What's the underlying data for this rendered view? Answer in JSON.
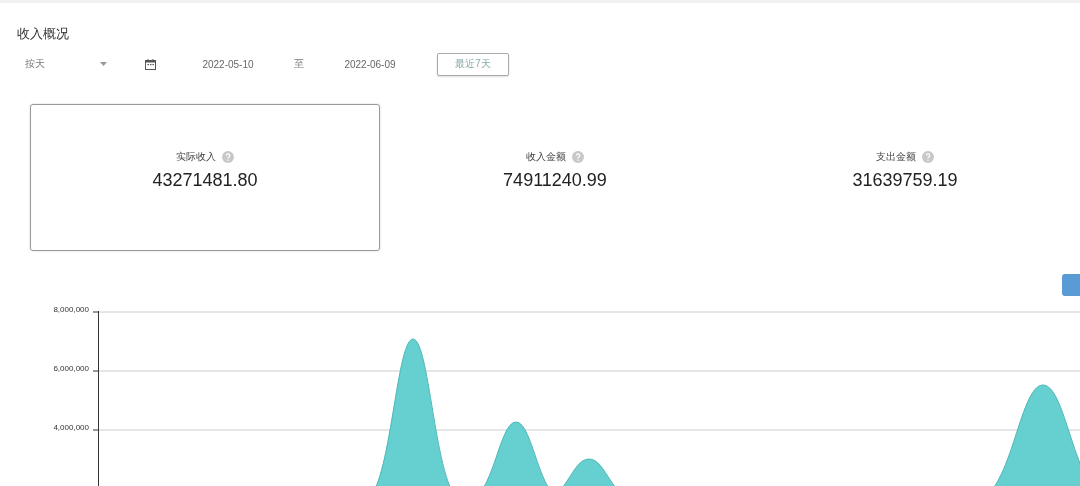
{
  "section_title": "收入概况",
  "filters": {
    "period": "按天",
    "start_date": "2022-05-10",
    "separator": "至",
    "end_date": "2022-06-09",
    "quick_button": "最近7天"
  },
  "stats": [
    {
      "label": "实际收入",
      "value": "43271481.80",
      "selected": true
    },
    {
      "label": "收入金额",
      "value": "74911240.99",
      "selected": false
    },
    {
      "label": "支出金额",
      "value": "31639759.19",
      "selected": false
    }
  ],
  "chart": {
    "y_tick_labels": [
      "8,000,000",
      "6,000,000",
      "4,000,000"
    ]
  }
}
